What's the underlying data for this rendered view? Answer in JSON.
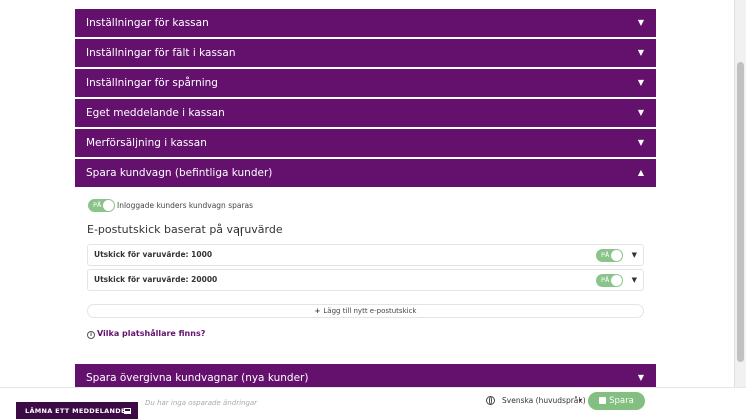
{
  "accordion": {
    "sections": [
      {
        "label": "Inställningar för kassan",
        "caret": "▼"
      },
      {
        "label": "Inställningar för fält i kassan",
        "caret": "▼"
      },
      {
        "label": "Inställningar för spårning",
        "caret": "▼"
      },
      {
        "label": "Eget meddelande i kassan",
        "caret": "▼"
      },
      {
        "label": "Merförsäljning i kassan",
        "caret": "▼"
      },
      {
        "label": "Spara kundvagn (befintliga kunder)",
        "caret": "▲"
      },
      {
        "label": "Spara övergivna kundvagnar (nya kunder)",
        "caret": "▼"
      }
    ]
  },
  "saved_cart": {
    "toggle_label": "PÅ",
    "toggle_text": "Inloggade kunders kundvagn sparas",
    "section_title": "E-postutskick baserat på varuvärde",
    "rows": [
      {
        "label": "Utskick för varuvärde: 1000",
        "toggle": "PÅ",
        "caret": "▼"
      },
      {
        "label": "Utskick för varuvärde: 20000",
        "toggle": "PÅ",
        "caret": "▼"
      }
    ],
    "add_label": "Lägg till nytt e-postutskick",
    "help_label": "Vilka platshållare finns?",
    "help_icon": "i"
  },
  "footer": {
    "leave_message": "LÄMNA ETT MEDDELANDE",
    "unsaved": "Du har inga osparade ändringar",
    "language": "Svenska (huvudspråk)",
    "language_caret": "▾",
    "save": "Spara"
  },
  "colors": {
    "accent": "#64116e",
    "toggle_on": "#8bc48a",
    "save": "#83bf80"
  }
}
